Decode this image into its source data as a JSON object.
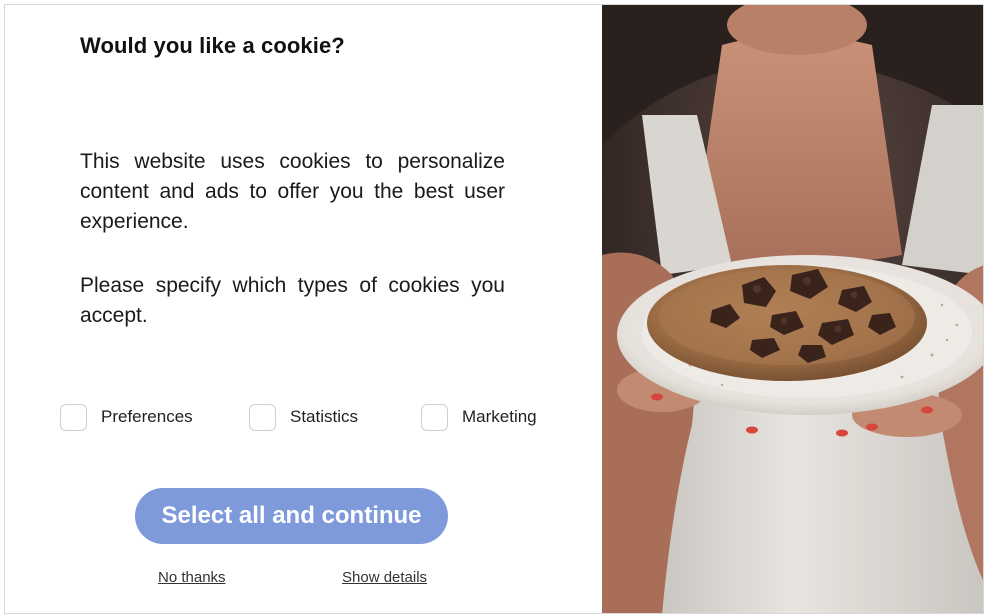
{
  "dialog": {
    "title": "Would you like a cookie?",
    "paragraph_1": "This website uses cookies to personalize content and ads to offer you the best user experience.",
    "paragraph_2": "Please specify which types of cookies you accept.",
    "checkboxes": [
      {
        "label": "Preferences",
        "checked": false
      },
      {
        "label": "Statistics",
        "checked": false
      },
      {
        "label": "Marketing",
        "checked": false
      }
    ],
    "primary_button": "Select all and continue",
    "decline_link": "No thanks",
    "details_link": "Show details"
  },
  "photo": {
    "subject": "woman-holding-chocolate-chip-cookie-on-plate"
  },
  "colors": {
    "button_bg": "#7e9ada",
    "button_text": "#ffffff",
    "title_text": "#111111",
    "checkbox_border": "#cfcfcf"
  }
}
